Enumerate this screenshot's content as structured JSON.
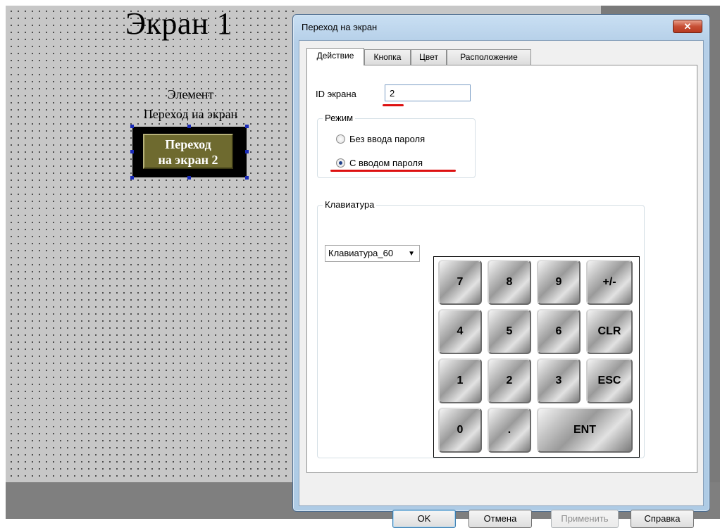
{
  "canvas": {
    "screen_title": "Экран 1",
    "element_description": [
      "Элемент",
      "Переход на экран"
    ],
    "goto_button_lines": [
      "Переход",
      "на экран 2"
    ]
  },
  "dialog": {
    "title": "Переход на экран",
    "tabs": [
      {
        "label": "Действие",
        "active": true
      },
      {
        "label": "Кнопка",
        "active": false
      },
      {
        "label": "Цвет",
        "active": false
      },
      {
        "label": "Расположение",
        "active": false
      }
    ],
    "screen_id": {
      "label": "ID экрана",
      "value": "2"
    },
    "mode": {
      "legend": "Режим",
      "options": [
        {
          "label": "Без ввода пароля",
          "checked": false
        },
        {
          "label": "С вводом пароля",
          "checked": true
        }
      ]
    },
    "keyboard": {
      "legend": "Клавиатура",
      "selected": "Клавиатура_60",
      "keys": [
        "7",
        "8",
        "9",
        "+/-",
        "4",
        "5",
        "6",
        "CLR",
        "1",
        "2",
        "3",
        "ESC",
        "0",
        ".",
        "ENT"
      ]
    },
    "buttons": {
      "ok": "OK",
      "cancel": "Отмена",
      "apply": "Применить",
      "help": "Справка"
    }
  },
  "colors": {
    "highlight_underline": "#dd1111",
    "button_face": "#6e6a2f"
  }
}
